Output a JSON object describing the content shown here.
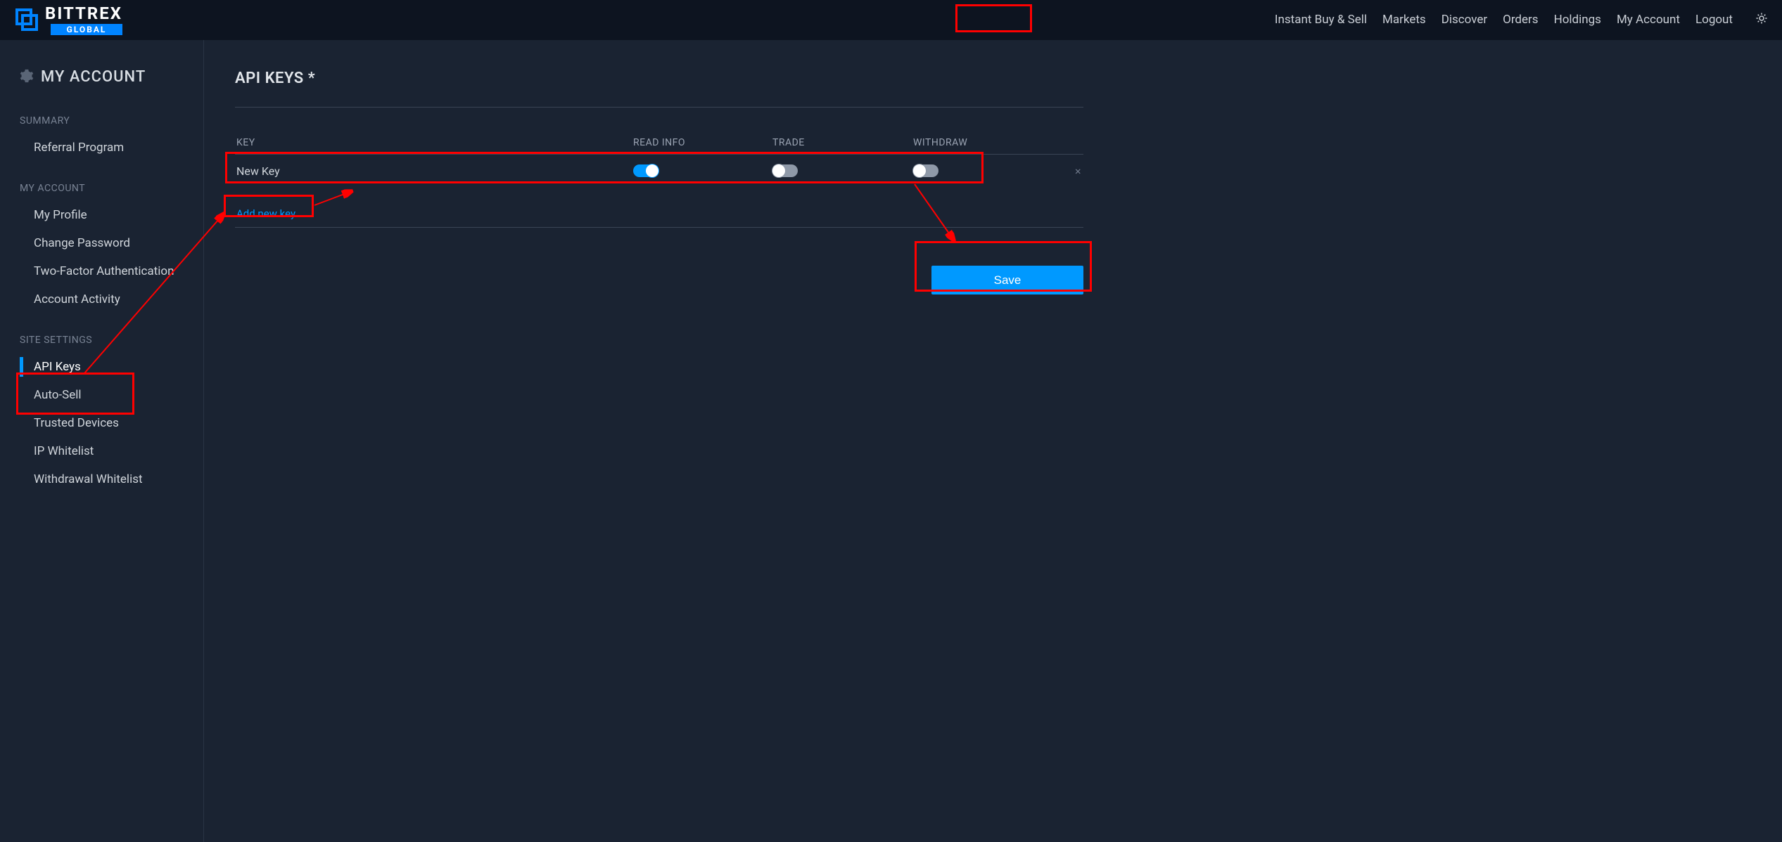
{
  "header": {
    "brand_main": "BITTREX",
    "brand_sub": "GLOBAL",
    "nav": {
      "instant": "Instant Buy & Sell",
      "markets": "Markets",
      "discover": "Discover",
      "orders": "Orders",
      "holdings": "Holdings",
      "my_account": "My Account",
      "logout": "Logout"
    }
  },
  "sidebar": {
    "title": "MY ACCOUNT",
    "groups": {
      "summary": {
        "label": "SUMMARY",
        "items": {
          "referral": "Referral Program"
        }
      },
      "account": {
        "label": "MY ACCOUNT",
        "items": {
          "profile": "My Profile",
          "password": "Change Password",
          "twofa": "Two-Factor Authentication",
          "activity": "Account Activity"
        }
      },
      "site": {
        "label": "SITE SETTINGS",
        "items": {
          "api_keys": "API Keys",
          "auto_sell": "Auto-Sell",
          "trusted": "Trusted Devices",
          "ip_whitelist": "IP Whitelist",
          "withdraw_whitelist": "Withdrawal Whitelist"
        }
      }
    }
  },
  "main": {
    "title": "API KEYS *",
    "columns": {
      "key": "KEY",
      "read": "READ INFO",
      "trade": "TRADE",
      "withdraw": "WITHDRAW"
    },
    "rows": [
      {
        "name": "New Key",
        "read": true,
        "trade": false,
        "withdraw": false
      }
    ],
    "add_new": "Add new key...",
    "save": "Save"
  },
  "colors": {
    "accent": "#0099ff",
    "bg": "#1a2332",
    "header_bg": "#0d1420",
    "highlight": "#f00"
  }
}
